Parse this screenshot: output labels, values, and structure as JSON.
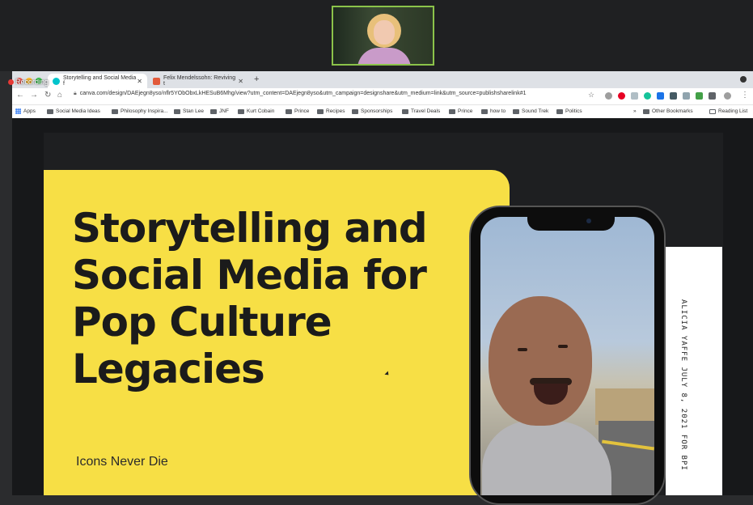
{
  "recording": {
    "label": "Recording"
  },
  "browser": {
    "tabs": [
      {
        "title": "Storytelling and Social Media f",
        "favicon_color": "#00c4cc"
      },
      {
        "title": "Felix Mendelssohn: Reviving t",
        "favicon_color": "#e25a3a"
      }
    ],
    "new_tab_icon": "plus-icon",
    "url": "canva.com/design/DAEjegn8yso/nflr5YObObxLkHESuB6Mhg/view?utm_content=DAEjegn8yso&utm_campaign=designshare&utm_medium=link&utm_source=publishsharelink#1",
    "bookmarks": [
      "Apps",
      "Social Media Ideas",
      "Philosophy Inspira...",
      "Stan Lee",
      "JNF",
      "Kurt Cobain",
      "Prince",
      "Recipes",
      "Sponsorships",
      "Travel Deals",
      "Prince",
      "how to",
      "Sound Trek",
      "Politics"
    ],
    "bookmarks_overflow": "»",
    "other_bookmarks": "Other Bookmarks",
    "reading_list": "Reading List"
  },
  "slide": {
    "title": "Storytelling and Social Media for Pop Culture Legacies",
    "subtitle": "Icons Never Die",
    "side_text": "ALICIA YAFFE JULY 8, 2021 FOR BPI"
  },
  "colors": {
    "accent_yellow": "#f7df45",
    "video_border": "#8bc34a"
  }
}
